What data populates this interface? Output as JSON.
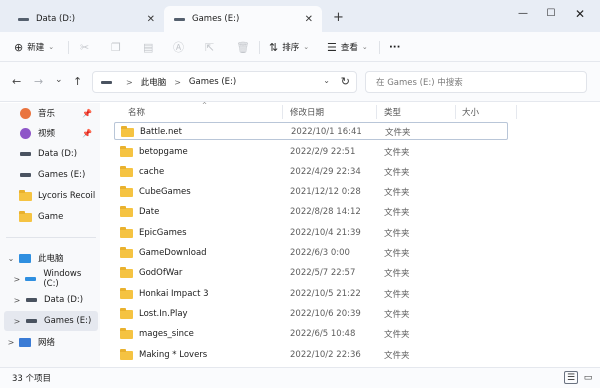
{
  "tabs": [
    {
      "label": "Data (D:)",
      "close": "✕"
    },
    {
      "label": "Games (E:)",
      "close": "✕"
    }
  ],
  "new_tab": "+",
  "window_controls": {
    "minimize": "—",
    "maximize": "☐",
    "close": "✕"
  },
  "toolbar": {
    "new_label": "新建",
    "sort_label": "排序",
    "view_label": "查看",
    "more": "···"
  },
  "nav": {
    "back": "←",
    "forward": "→",
    "recent": "⌄",
    "up": "↑"
  },
  "address": {
    "crumbs": [
      "此电脑",
      "Games (E:)"
    ],
    "separator": ">",
    "dropdown": "⌄",
    "refresh": "↻"
  },
  "search": {
    "placeholder": "在 Games (E:) 中搜索"
  },
  "sidebar": {
    "items": [
      {
        "label": "音乐",
        "icon": "music-icon",
        "pinned": true
      },
      {
        "label": "视频",
        "icon": "video-icon",
        "pinned": true
      },
      {
        "label": "Data (D:)",
        "icon": "drive-icon"
      },
      {
        "label": "Games (E:)",
        "icon": "drive-icon"
      },
      {
        "label": "Lycoris Recoil",
        "icon": "folder-icon"
      },
      {
        "label": "Game",
        "icon": "folder-icon"
      },
      {
        "label": "此电脑",
        "icon": "pc-icon",
        "expander": "⌄"
      },
      {
        "label": "Windows (C:)",
        "icon": "windows-drive-icon",
        "expander": ">"
      },
      {
        "label": "Data (D:)",
        "icon": "drive-icon",
        "expander": ">"
      },
      {
        "label": "Games (E:)",
        "icon": "drive-icon",
        "expander": ">",
        "selected": true
      },
      {
        "label": "网络",
        "icon": "network-icon",
        "expander": ">"
      }
    ]
  },
  "columns": {
    "name": "名称",
    "date": "修改日期",
    "type": "类型",
    "size": "大小"
  },
  "rows": [
    {
      "name": "Battle.net",
      "date": "2022/10/1 16:41",
      "type": "文件夹"
    },
    {
      "name": "betopgame",
      "date": "2022/2/9 22:51",
      "type": "文件夹"
    },
    {
      "name": "cache",
      "date": "2022/4/29 22:34",
      "type": "文件夹"
    },
    {
      "name": "CubeGames",
      "date": "2021/12/12 0:28",
      "type": "文件夹"
    },
    {
      "name": "Date",
      "date": "2022/8/28 14:12",
      "type": "文件夹"
    },
    {
      "name": "EpicGames",
      "date": "2022/10/4 21:39",
      "type": "文件夹"
    },
    {
      "name": "GameDownload",
      "date": "2022/6/3 0:00",
      "type": "文件夹"
    },
    {
      "name": "GodOfWar",
      "date": "2022/5/7 22:57",
      "type": "文件夹"
    },
    {
      "name": "Honkai Impact 3",
      "date": "2022/10/5 21:22",
      "type": "文件夹"
    },
    {
      "name": "Lost.In.Play",
      "date": "2022/10/6 20:39",
      "type": "文件夹"
    },
    {
      "name": "mages_since",
      "date": "2022/6/5 10:48",
      "type": "文件夹"
    },
    {
      "name": "Making * Lovers",
      "date": "2022/10/2 22:36",
      "type": "文件夹"
    }
  ],
  "status": {
    "count": "33 个项目"
  }
}
